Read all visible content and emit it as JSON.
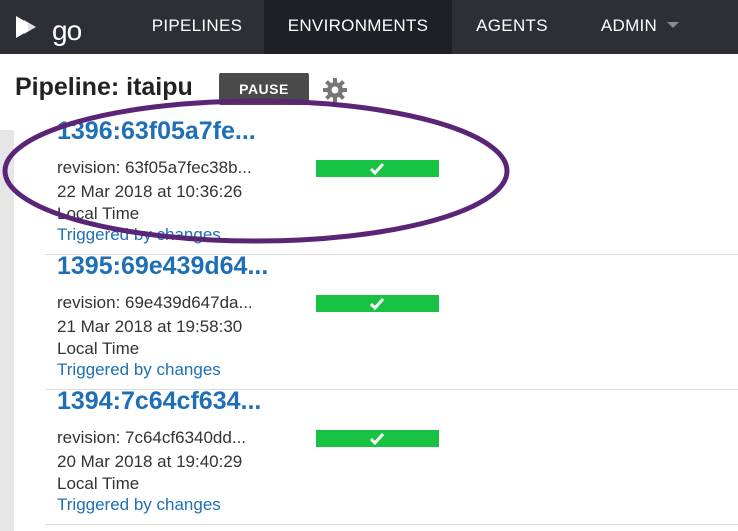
{
  "nav": {
    "logo_text": "go",
    "items": [
      {
        "label": "PIPELINES"
      },
      {
        "label": "ENVIRONMENTS"
      },
      {
        "label": "AGENTS"
      },
      {
        "label": "ADMIN"
      }
    ]
  },
  "page": {
    "title": "Pipeline: itaipu",
    "pause_label": "PAUSE"
  },
  "runs": [
    {
      "label": "1396:63f05a7fe...",
      "revision": "revision: 63f05a7fec38b...",
      "date": "22 Mar 2018 at 10:36:26",
      "tz": "Local Time",
      "trigger": "Triggered by changes",
      "stage_status": "passed"
    },
    {
      "label": "1395:69e439d64...",
      "revision": "revision: 69e439d647da...",
      "date": "21 Mar 2018 at 19:58:30",
      "tz": "Local Time",
      "trigger": "Triggered by changes",
      "stage_status": "passed"
    },
    {
      "label": "1394:7c64cf634...",
      "revision": "revision: 7c64cf6340dd...",
      "date": "20 Mar 2018 at 19:40:29",
      "tz": "Local Time",
      "trigger": "Triggered by changes",
      "stage_status": "passed"
    }
  ],
  "colors": {
    "topbar": "#2d2e36",
    "link": "#1e6fb5",
    "stage_passed": "#18c343",
    "highlight_ellipse": "#5b2577"
  },
  "icons": {
    "logo": "go-logo-icon",
    "settings": "gear-icon",
    "stage": "checkmark-icon",
    "admin_menu": "caret-down-icon"
  }
}
